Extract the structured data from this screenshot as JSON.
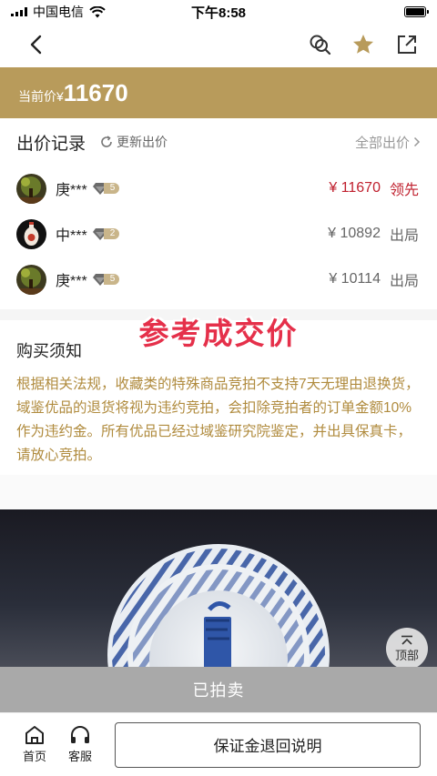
{
  "status_bar": {
    "carrier": "中国电信",
    "time": "下午8:58"
  },
  "price_banner": {
    "label": "当前价¥",
    "value": "11670"
  },
  "bids": {
    "title": "出价记录",
    "refresh_label": "更新出价",
    "all_label": "全部出价",
    "rows": [
      {
        "name": "庚***",
        "level": "5",
        "amount": "¥ 11670",
        "status": "领先",
        "lead": true
      },
      {
        "name": "中***",
        "level": "2",
        "amount": "¥ 10892",
        "status": "出局",
        "lead": false
      },
      {
        "name": "庚***",
        "level": "5",
        "amount": "¥ 10114",
        "status": "出局",
        "lead": false
      }
    ]
  },
  "watermark": "参考成交价",
  "notice": {
    "title": "购买须知",
    "text": "根据相关法规，收藏类的特殊商品竞拍不支持7天无理由退换货，域鉴优品的退货将视为违约竞拍，会扣除竞拍者的订单金额10%作为违约金。所有优品已经过域鉴研究院鉴定，并出具保真卡，请放心竞拍。"
  },
  "top_button_label": "顶部",
  "sold_label": "已拍卖",
  "bottom_bar": {
    "home_label": "首页",
    "service_label": "客服",
    "deposit_button": "保证金退回说明"
  },
  "colors": {
    "gold": "#b89b5b",
    "lead_red": "#c0212f",
    "notice_gold": "#b08b3e"
  }
}
